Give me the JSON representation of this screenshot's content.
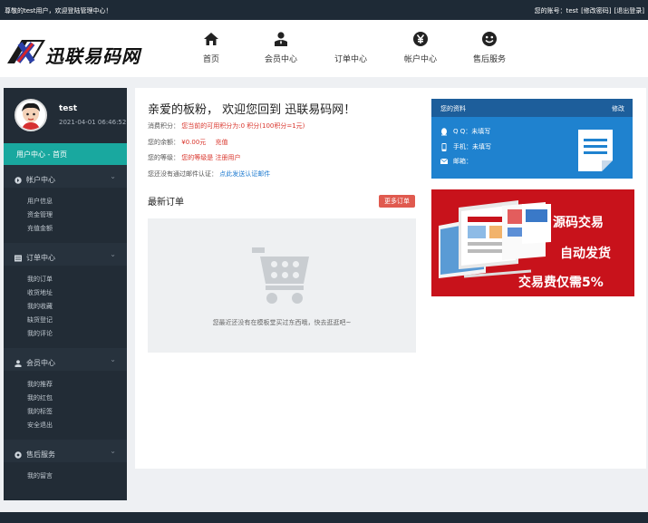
{
  "topbar": {
    "greeting": "尊敬的test用户，欢迎登陆管理中心！",
    "account_label": "您的账号：test",
    "change_password": "[修改密码]",
    "logout": "[退出登录]"
  },
  "logo": {
    "text": "迅联易码网"
  },
  "nav": [
    {
      "label": "首页",
      "icon": "home-icon"
    },
    {
      "label": "会员中心",
      "icon": "user-icon"
    },
    {
      "label": "订单中心",
      "icon": "order-icon"
    },
    {
      "label": "帐户中心",
      "icon": "yen-icon"
    },
    {
      "label": "售后服务",
      "icon": "smile-icon"
    }
  ],
  "sidebar": {
    "username": "test",
    "login_time": "2021-04-01 06:46:52",
    "active": "用户中心 - 首页",
    "sections": [
      {
        "title": "帐户中心",
        "items": [
          "用户信息",
          "资金管理",
          "充值金额"
        ]
      },
      {
        "title": "订单中心",
        "items": [
          "我的订单",
          "收货地址",
          "我的收藏",
          "缺货登记",
          "我的评论"
        ]
      },
      {
        "title": "会员中心",
        "items": [
          "我的推荐",
          "我的红包",
          "我的标签",
          "安全退出"
        ]
      },
      {
        "title": "售后服务",
        "items": [
          "我的留言"
        ]
      }
    ]
  },
  "main": {
    "welcome": "亲爱的板粉， 欢迎您回到 迅联易码网！",
    "points_label": "消费积分：",
    "points_value": "您当前的可用积分为:0 积分(100积分=1元)",
    "balance_label": "您的余额：",
    "balance_value": "¥0.00元",
    "recharge": "充值",
    "level_label": "您的等级：",
    "level_value": "您的等级是 注册用户",
    "email_label": "您还没有通过邮件认证：",
    "email_link": "点此发送认证邮件",
    "orders_title": "最新订单",
    "more_orders": "更多订单",
    "empty_text": "您最近还没有在模板堂买过东西哦，快去逛逛吧~"
  },
  "profile_card": {
    "title": "您的资料",
    "edit": "修改",
    "qq": "Q Q：未填写",
    "phone": "手机：未填写",
    "email": "邮箱："
  },
  "ad": {
    "line1": "源码交易",
    "line2": "自动发货",
    "line3": "交易费仅需5%"
  },
  "colors": {
    "accent": "#19a89f",
    "sidebar": "#222c36",
    "ad_red": "#c8121b",
    "card_blue": "#1f82cf"
  }
}
